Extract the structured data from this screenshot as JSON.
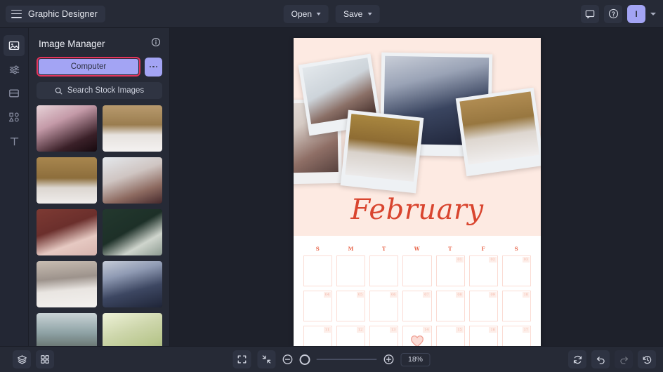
{
  "header": {
    "brand_title": "Graphic Designer",
    "menu_icon": "hamburger-icon",
    "open_label": "Open",
    "save_label": "Save",
    "comment_icon": "comment-icon",
    "help_icon": "help-circle-icon",
    "avatar_initial": "I"
  },
  "rail": {
    "items": [
      {
        "name": "images",
        "icon": "image-icon",
        "active": true
      },
      {
        "name": "adjustments",
        "icon": "sliders-icon",
        "active": false
      },
      {
        "name": "layout",
        "icon": "frame-icon",
        "active": false
      },
      {
        "name": "shapes",
        "icon": "shapes-icon",
        "active": false
      },
      {
        "name": "text",
        "icon": "text-icon",
        "active": false
      }
    ]
  },
  "panel": {
    "title": "Image Manager",
    "info_icon": "info-circle-icon",
    "computer_label": "Computer",
    "overflow_icon": "more-horizontal-icon",
    "search_placeholder": "Search Stock Images",
    "search_icon": "search-icon",
    "highlight_color": "#e5345c",
    "accent_color": "#a3a4f4",
    "thumbnails": [
      {
        "name": "thumb-portrait-flash",
        "tone": "#c49aa8"
      },
      {
        "name": "thumb-love-letters-bed",
        "tone": "#b89a6e"
      },
      {
        "name": "thumb-couple-bed-gold",
        "tone": "#a8864e"
      },
      {
        "name": "thumb-couple-hug-white",
        "tone": "#cfc5c2"
      },
      {
        "name": "thumb-couple-dark-red",
        "tone": "#6b2f2c"
      },
      {
        "name": "thumb-portrait-dark-green",
        "tone": "#1d3028"
      },
      {
        "name": "thumb-robes-bed",
        "tone": "#9d938c"
      },
      {
        "name": "thumb-couple-formal",
        "tone": "#4a5670"
      },
      {
        "name": "thumb-beach-sunset",
        "tone": "#8fa3a6"
      },
      {
        "name": "thumb-cocktail-glass",
        "tone": "#cdd6ab"
      }
    ]
  },
  "canvas": {
    "page_background": "#fdeae2",
    "month_label": "February",
    "month_color": "#d9452f",
    "weekdays": [
      "S",
      "M",
      "T",
      "W",
      "T",
      "F",
      "S"
    ],
    "weeks": [
      [
        "",
        "",
        "",
        "",
        "01",
        "02",
        "03"
      ],
      [
        "04",
        "05",
        "06",
        "07",
        "08",
        "09",
        "10"
      ],
      [
        "11",
        "12",
        "13",
        "14",
        "15",
        "16",
        "17"
      ]
    ],
    "heart_day": "14",
    "photos": [
      {
        "name": "photo-couple-hug-large",
        "tone": "#d8d2cd"
      },
      {
        "name": "photo-portrait-tilt",
        "tone": "#cfd4d8"
      },
      {
        "name": "photo-couple-formal-center",
        "tone": "#3f4a63"
      },
      {
        "name": "photo-couple-bed-gold",
        "tone": "#9d7c3f"
      },
      {
        "name": "photo-love-letters-right",
        "tone": "#ad8b55"
      }
    ]
  },
  "bottombar": {
    "layers_icon": "layers-icon",
    "grid_icon": "grid-icon",
    "fit_icon": "fit-screen-icon",
    "shrink_icon": "shrink-icon",
    "zoom_out_icon": "zoom-out-icon",
    "zoom_in_icon": "zoom-in-icon",
    "zoom_value": "18%",
    "reset_icon": "refresh-icon",
    "undo_icon": "undo-icon",
    "redo_icon": "redo-icon",
    "history_icon": "history-icon"
  }
}
